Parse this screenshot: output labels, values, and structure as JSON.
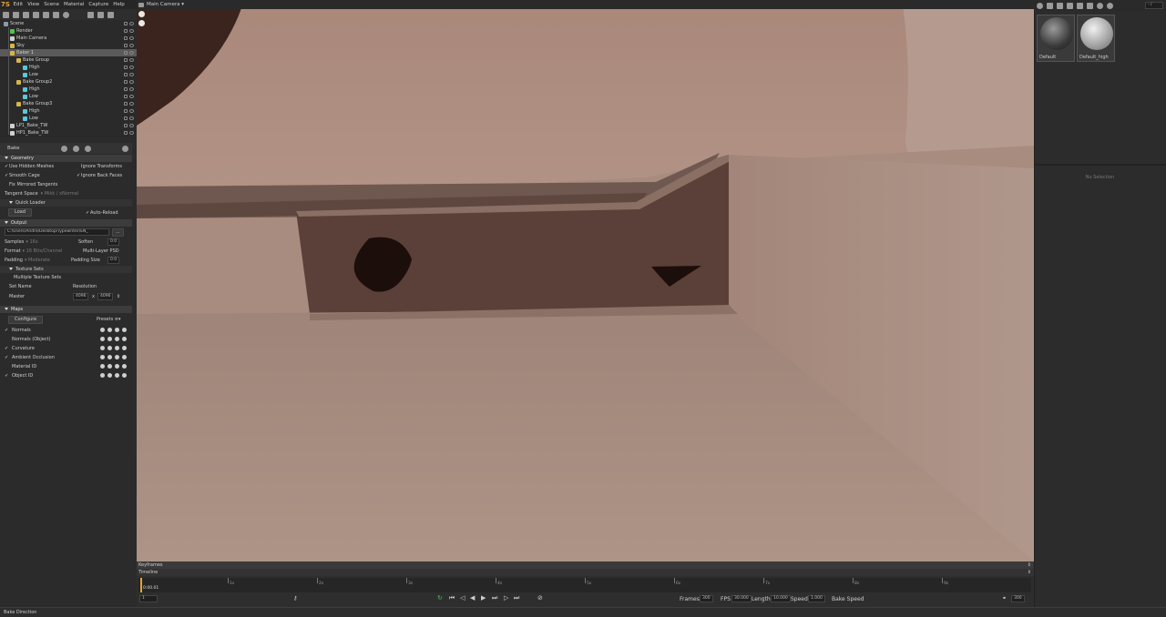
{
  "menubar": {
    "logo": "7S",
    "items": [
      "Edit",
      "View",
      "Scene",
      "Material",
      "Capture",
      "Help"
    ]
  },
  "toolbar": {
    "icons": [
      "cube-icon",
      "light-icon",
      "camera-icon",
      "image-icon",
      "duplicate-icon",
      "group-icon",
      "sphere-icon",
      "folder-icon",
      "copy-icon",
      "delete-icon"
    ]
  },
  "viewport": {
    "camera": "Main Camera"
  },
  "outliner": {
    "rows": [
      {
        "label": "Scene",
        "type": "scene",
        "indent": 0
      },
      {
        "label": "Render",
        "type": "render",
        "indent": 1
      },
      {
        "label": "Main Camera",
        "type": "camera",
        "indent": 1
      },
      {
        "label": "Sky",
        "type": "sky",
        "indent": 1
      },
      {
        "label": "Baker 1",
        "type": "baker",
        "indent": 1,
        "selected": true
      },
      {
        "label": "Bake Group",
        "type": "folder",
        "indent": 2
      },
      {
        "label": "High",
        "type": "mesh",
        "indent": 3
      },
      {
        "label": "Low",
        "type": "mesh",
        "indent": 3
      },
      {
        "label": "Bake Group2",
        "type": "folder",
        "indent": 2
      },
      {
        "label": "High",
        "type": "mesh",
        "indent": 3
      },
      {
        "label": "Low",
        "type": "mesh",
        "indent": 3
      },
      {
        "label": "Bake Group3",
        "type": "folder",
        "indent": 2
      },
      {
        "label": "High",
        "type": "mesh",
        "indent": 3
      },
      {
        "label": "Low",
        "type": "mesh",
        "indent": 3
      },
      {
        "label": "LP1_Bake_TW",
        "type": "file",
        "indent": 1
      },
      {
        "label": "HP1_Bake_TW",
        "type": "file",
        "indent": 1
      }
    ]
  },
  "props": {
    "title": "Bake",
    "geometry": {
      "header": "Geometry",
      "use_hidden_meshes": "Use Hidden Meshes",
      "ignore_transforms": "Ignore Transforms",
      "smooth_cage": "Smooth Cage",
      "ignore_back_faces": "Ignore Back Faces",
      "fix_mirrored": "Fix Mirrored Tangents",
      "tangent_space_label": "Tangent Space",
      "tangent_space_value": "Mikk / xNormal"
    },
    "quick_loader": {
      "header": "Quick Loader",
      "load": "Load",
      "auto_reload": "Auto-Reload"
    },
    "output": {
      "header": "Output",
      "path": "C:/Users/Andre/Desktop/Typewriter/EN_",
      "browse": "...",
      "samples_label": "Samples",
      "samples_value": "16x",
      "soften_label": "Soften",
      "soften_value": "0.0",
      "format_label": "Format",
      "format_value": "16 Bits/Channel",
      "multilayer": "Multi-Layer PSD",
      "padding_label": "Padding",
      "padding_value": "Moderate",
      "padding_size_label": "Padding Size",
      "padding_size_value": "0.0"
    },
    "texture_sets": {
      "header": "Texture Sets",
      "multiple": "Multiple Texture Sets",
      "set_name": "Set Name",
      "resolution": "Resolution",
      "master": "Master",
      "width": "4096",
      "x": "x",
      "height": "4096"
    },
    "maps": {
      "header": "Maps",
      "configure": "Configure",
      "presets": "Presets",
      "items": [
        {
          "label": "Normals",
          "checked": true
        },
        {
          "label": "Normals (Object)",
          "checked": false
        },
        {
          "label": "Curvature",
          "checked": true
        },
        {
          "label": "Ambient Occlusion",
          "checked": true
        },
        {
          "label": "Material ID",
          "checked": false
        },
        {
          "label": "Object ID",
          "checked": true
        }
      ]
    }
  },
  "timeline": {
    "keyframes": "Keyframes",
    "timeline": "Timeline",
    "ticks": [
      "1s",
      "2s",
      "3s",
      "4s",
      "5s",
      "6s",
      "7s",
      "8s",
      "9s"
    ],
    "current_time": "0:00.01",
    "frame_field": "1",
    "frames_label": "Frames",
    "frames_value": "300",
    "fps_label": "FPS",
    "fps_value": "30.000",
    "length_label": "Length",
    "length_value": "10.000",
    "speed_label": "Speed",
    "speed_value": "1.000",
    "bake_speed": "Bake Speed",
    "end_value": "300"
  },
  "status": {
    "text": "Bake Direction"
  },
  "materials": {
    "items": [
      {
        "name": "Default"
      },
      {
        "name": "Default_high"
      }
    ],
    "no_selection": "No Selection",
    "search": "- /"
  },
  "colors": {
    "accent": "#e8a33a",
    "viewport_bg": "#b6998c",
    "selected_row": "#5a5a5a"
  }
}
